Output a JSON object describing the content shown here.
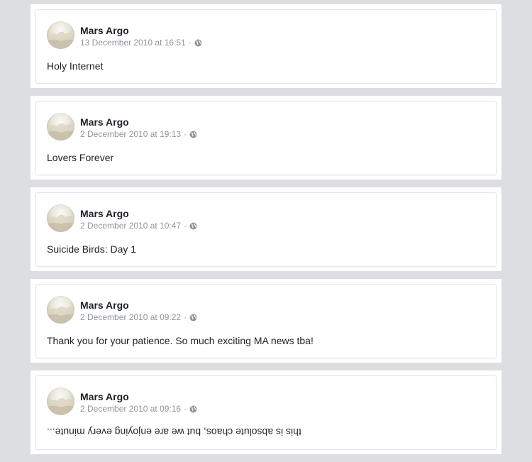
{
  "posts": [
    {
      "author": "Mars Argo",
      "timestamp": "13 December 2010 at 16:51",
      "separator": "·",
      "privacy_icon": "globe-icon",
      "text": "Holy Internet"
    },
    {
      "author": "Mars Argo",
      "timestamp": "2 December 2010 at 19:13",
      "separator": "·",
      "privacy_icon": "globe-icon",
      "text": "Lovers Forever"
    },
    {
      "author": "Mars Argo",
      "timestamp": "2 December 2010 at 10:47",
      "separator": "·",
      "privacy_icon": "globe-icon",
      "text": "Suicide Birds: Day 1"
    },
    {
      "author": "Mars Argo",
      "timestamp": "2 December 2010 at 09:22",
      "separator": "·",
      "privacy_icon": "globe-icon",
      "text": "Thank you for your patience. So much exciting MA news tba!"
    },
    {
      "author": "Mars Argo",
      "timestamp": "2 December 2010 at 09:16",
      "separator": "·",
      "privacy_icon": "globe-icon",
      "text": "this is absolute chaos, but we are enjoying every minute...",
      "text_rendering": "upside-down"
    }
  ],
  "colors": {
    "page_background": "#dddee2",
    "card_background": "#ffffff",
    "author_text": "#1d2129",
    "meta_text": "#90949c"
  }
}
